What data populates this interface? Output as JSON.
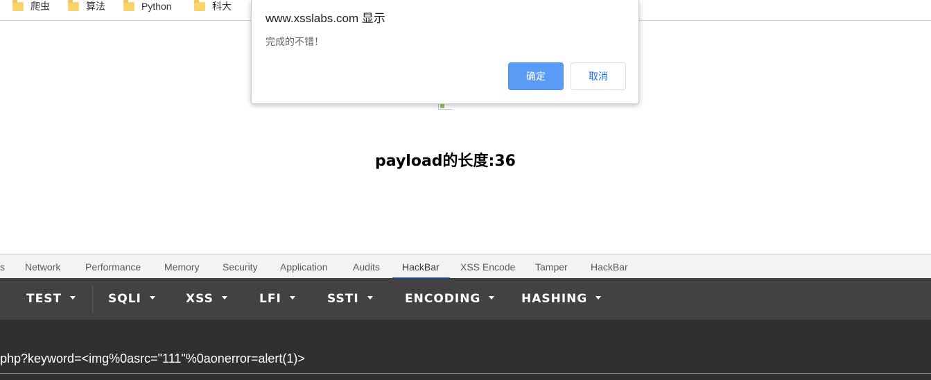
{
  "bookmarks": [
    {
      "label": "爬虫",
      "icon": "folder-icon"
    },
    {
      "label": "算法",
      "icon": "folder-icon"
    },
    {
      "label": "Python",
      "icon": "folder-icon"
    },
    {
      "label": "科大",
      "icon": "folder-icon"
    }
  ],
  "dialog": {
    "title": "www.xsslabs.com 显示",
    "message": "完成的不错！",
    "ok_label": "确定",
    "cancel_label": "取消"
  },
  "page": {
    "payload_length": "payload的长度:36"
  },
  "devtools": {
    "tabs": [
      "s",
      "Network",
      "Performance",
      "Memory",
      "Security",
      "Application",
      "Audits",
      "HackBar",
      "XSS Encode",
      "Tamper",
      "HackBar"
    ],
    "active_tab": "HackBar"
  },
  "hackbar": {
    "menus": [
      "TEST",
      "SQLI",
      "XSS",
      "LFI",
      "SSTI",
      "ENCODING",
      "HASHING"
    ],
    "url": "php?keyword=<img%0asrc=\"111\"%0aonerror=alert(1)>"
  },
  "colors": {
    "dialog_ok": "#5a9bf5",
    "active_tab_indicator": "#1a73e8",
    "hackbar_toolbar": "#424242",
    "hackbar_url_area": "#303030"
  }
}
